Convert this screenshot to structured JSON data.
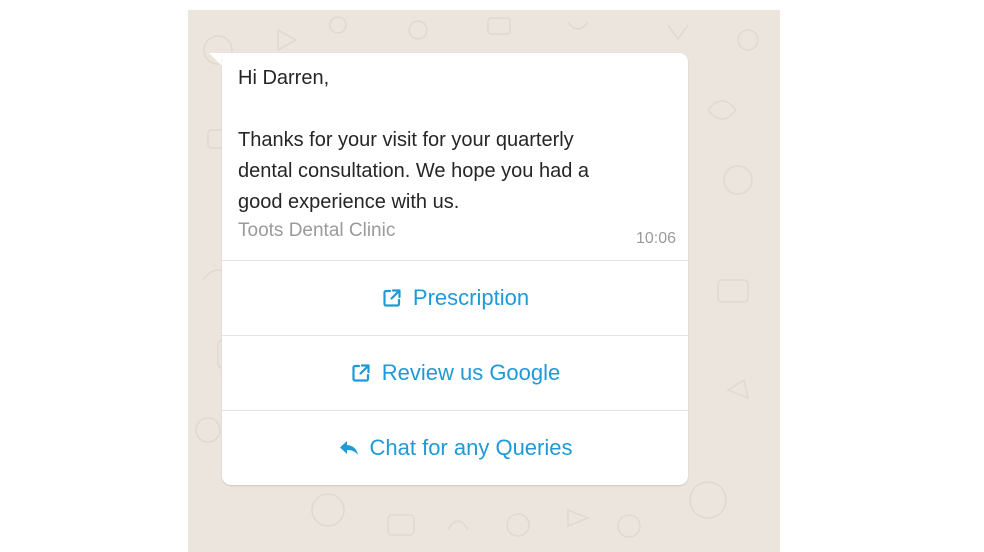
{
  "message": {
    "text": "Hi Darren,\n\nThanks for your visit for your quarterly\ndental consultation. We hope you had a\ngood experience with us.",
    "footer": "Toots Dental Clinic",
    "time": "10:06"
  },
  "buttons": [
    {
      "label": "Prescription",
      "icon": "external-link-icon"
    },
    {
      "label": "Review us Google",
      "icon": "external-link-icon"
    },
    {
      "label": "Chat for any Queries",
      "icon": "reply-icon"
    }
  ],
  "colors": {
    "chat_background": "#ece5dd",
    "bubble": "#ffffff",
    "button_text": "#1f9ad6",
    "message_text": "#262626",
    "meta_text": "#9a9a9a"
  }
}
